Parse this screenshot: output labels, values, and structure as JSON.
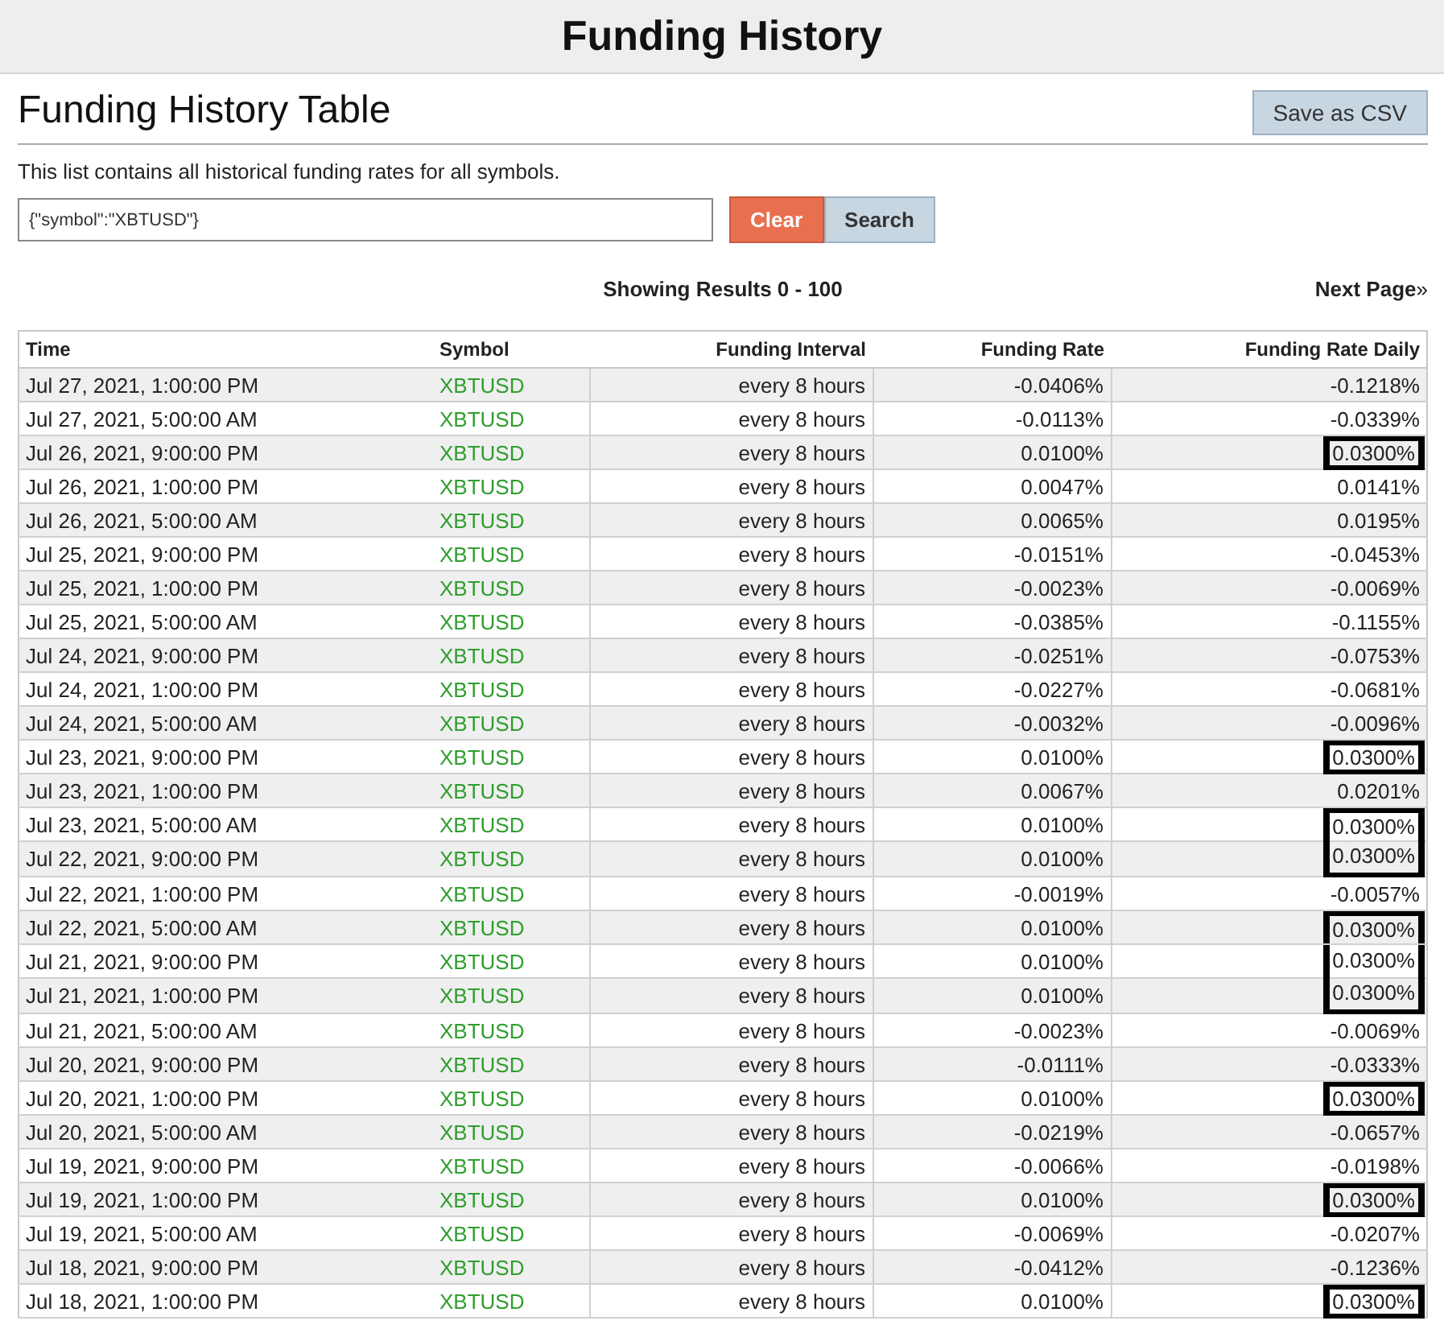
{
  "page_title": "Funding History",
  "section_title": "Funding History Table",
  "save_button": "Save as CSV",
  "description": "This list contains all historical funding rates for all symbols.",
  "filter": {
    "value": "{\"symbol\":\"XBTUSD\"}"
  },
  "clear_button": "Clear",
  "search_button": "Search",
  "results_label": "Showing Results 0 - 100",
  "next_page": "Next Page",
  "next_page_icon": "»",
  "table": {
    "columns": [
      "Time",
      "Symbol",
      "Funding Interval",
      "Funding Rate",
      "Funding Rate Daily"
    ],
    "rows": [
      {
        "time": "Jul 27, 2021, 1:00:00 PM",
        "symbol": "XBTUSD",
        "interval": "every 8 hours",
        "rate": "-0.0406%",
        "daily": "-0.1218%",
        "highlighted": false
      },
      {
        "time": "Jul 27, 2021, 5:00:00 AM",
        "symbol": "XBTUSD",
        "interval": "every 8 hours",
        "rate": "-0.0113%",
        "daily": "-0.0339%",
        "highlighted": false
      },
      {
        "time": "Jul 26, 2021, 9:00:00 PM",
        "symbol": "XBTUSD",
        "interval": "every 8 hours",
        "rate": "0.0100%",
        "daily": "0.0300%",
        "highlighted": true
      },
      {
        "time": "Jul 26, 2021, 1:00:00 PM",
        "symbol": "XBTUSD",
        "interval": "every 8 hours",
        "rate": "0.0047%",
        "daily": "0.0141%",
        "highlighted": false
      },
      {
        "time": "Jul 26, 2021, 5:00:00 AM",
        "symbol": "XBTUSD",
        "interval": "every 8 hours",
        "rate": "0.0065%",
        "daily": "0.0195%",
        "highlighted": false
      },
      {
        "time": "Jul 25, 2021, 9:00:00 PM",
        "symbol": "XBTUSD",
        "interval": "every 8 hours",
        "rate": "-0.0151%",
        "daily": "-0.0453%",
        "highlighted": false
      },
      {
        "time": "Jul 25, 2021, 1:00:00 PM",
        "symbol": "XBTUSD",
        "interval": "every 8 hours",
        "rate": "-0.0023%",
        "daily": "-0.0069%",
        "highlighted": false
      },
      {
        "time": "Jul 25, 2021, 5:00:00 AM",
        "symbol": "XBTUSD",
        "interval": "every 8 hours",
        "rate": "-0.0385%",
        "daily": "-0.1155%",
        "highlighted": false
      },
      {
        "time": "Jul 24, 2021, 9:00:00 PM",
        "symbol": "XBTUSD",
        "interval": "every 8 hours",
        "rate": "-0.0251%",
        "daily": "-0.0753%",
        "highlighted": false
      },
      {
        "time": "Jul 24, 2021, 1:00:00 PM",
        "symbol": "XBTUSD",
        "interval": "every 8 hours",
        "rate": "-0.0227%",
        "daily": "-0.0681%",
        "highlighted": false
      },
      {
        "time": "Jul 24, 2021, 5:00:00 AM",
        "symbol": "XBTUSD",
        "interval": "every 8 hours",
        "rate": "-0.0032%",
        "daily": "-0.0096%",
        "highlighted": false
      },
      {
        "time": "Jul 23, 2021, 9:00:00 PM",
        "symbol": "XBTUSD",
        "interval": "every 8 hours",
        "rate": "0.0100%",
        "daily": "0.0300%",
        "highlighted": true
      },
      {
        "time": "Jul 23, 2021, 1:00:00 PM",
        "symbol": "XBTUSD",
        "interval": "every 8 hours",
        "rate": "0.0067%",
        "daily": "0.0201%",
        "highlighted": false
      },
      {
        "time": "Jul 23, 2021, 5:00:00 AM",
        "symbol": "XBTUSD",
        "interval": "every 8 hours",
        "rate": "0.0100%",
        "daily": "0.0300%",
        "highlighted": true
      },
      {
        "time": "Jul 22, 2021, 9:00:00 PM",
        "symbol": "XBTUSD",
        "interval": "every 8 hours",
        "rate": "0.0100%",
        "daily": "0.0300%",
        "highlighted": true
      },
      {
        "time": "Jul 22, 2021, 1:00:00 PM",
        "symbol": "XBTUSD",
        "interval": "every 8 hours",
        "rate": "-0.0019%",
        "daily": "-0.0057%",
        "highlighted": false
      },
      {
        "time": "Jul 22, 2021, 5:00:00 AM",
        "symbol": "XBTUSD",
        "interval": "every 8 hours",
        "rate": "0.0100%",
        "daily": "0.0300%",
        "highlighted": true
      },
      {
        "time": "Jul 21, 2021, 9:00:00 PM",
        "symbol": "XBTUSD",
        "interval": "every 8 hours",
        "rate": "0.0100%",
        "daily": "0.0300%",
        "highlighted": true
      },
      {
        "time": "Jul 21, 2021, 1:00:00 PM",
        "symbol": "XBTUSD",
        "interval": "every 8 hours",
        "rate": "0.0100%",
        "daily": "0.0300%",
        "highlighted": true
      },
      {
        "time": "Jul 21, 2021, 5:00:00 AM",
        "symbol": "XBTUSD",
        "interval": "every 8 hours",
        "rate": "-0.0023%",
        "daily": "-0.0069%",
        "highlighted": false
      },
      {
        "time": "Jul 20, 2021, 9:00:00 PM",
        "symbol": "XBTUSD",
        "interval": "every 8 hours",
        "rate": "-0.0111%",
        "daily": "-0.0333%",
        "highlighted": false
      },
      {
        "time": "Jul 20, 2021, 1:00:00 PM",
        "symbol": "XBTUSD",
        "interval": "every 8 hours",
        "rate": "0.0100%",
        "daily": "0.0300%",
        "highlighted": true
      },
      {
        "time": "Jul 20, 2021, 5:00:00 AM",
        "symbol": "XBTUSD",
        "interval": "every 8 hours",
        "rate": "-0.0219%",
        "daily": "-0.0657%",
        "highlighted": false
      },
      {
        "time": "Jul 19, 2021, 9:00:00 PM",
        "symbol": "XBTUSD",
        "interval": "every 8 hours",
        "rate": "-0.0066%",
        "daily": "-0.0198%",
        "highlighted": false
      },
      {
        "time": "Jul 19, 2021, 1:00:00 PM",
        "symbol": "XBTUSD",
        "interval": "every 8 hours",
        "rate": "0.0100%",
        "daily": "0.0300%",
        "highlighted": true
      },
      {
        "time": "Jul 19, 2021, 5:00:00 AM",
        "symbol": "XBTUSD",
        "interval": "every 8 hours",
        "rate": "-0.0069%",
        "daily": "-0.0207%",
        "highlighted": false
      },
      {
        "time": "Jul 18, 2021, 9:00:00 PM",
        "symbol": "XBTUSD",
        "interval": "every 8 hours",
        "rate": "-0.0412%",
        "daily": "-0.1236%",
        "highlighted": false
      },
      {
        "time": "Jul 18, 2021, 1:00:00 PM",
        "symbol": "XBTUSD",
        "interval": "every 8 hours",
        "rate": "0.0100%",
        "daily": "0.0300%",
        "highlighted": true
      }
    ]
  }
}
